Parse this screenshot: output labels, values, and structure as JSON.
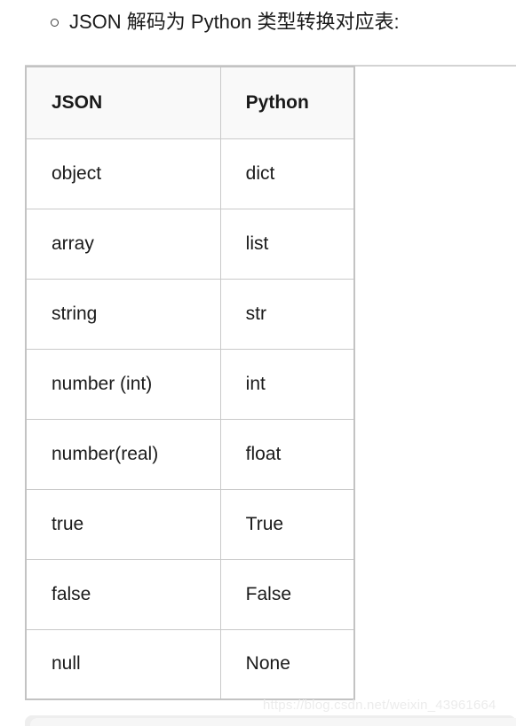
{
  "heading": {
    "bullet_icon": "circle-outline-icon",
    "text": "JSON 解码为 Python 类型转换对应表:"
  },
  "table": {
    "headers": [
      "JSON",
      "Python"
    ],
    "rows": [
      [
        "object",
        "dict"
      ],
      [
        "array",
        "list"
      ],
      [
        "string",
        "str"
      ],
      [
        "number (int)",
        "int"
      ],
      [
        "number(real)",
        "float"
      ],
      [
        "true",
        "True"
      ],
      [
        "false",
        "False"
      ],
      [
        "null",
        "None"
      ]
    ]
  },
  "watermark": {
    "text": "https://blog.csdn.net/weixin_43961664"
  },
  "colors": {
    "table_outer_border": "#c3c3c3",
    "table_inner_border": "#c9c9c9",
    "header_background": "#f9f9f9",
    "text": "#1a1a1a",
    "watermark": "#ececec",
    "rule": "#d3d3d3",
    "code_panel": "#eeeeee"
  }
}
